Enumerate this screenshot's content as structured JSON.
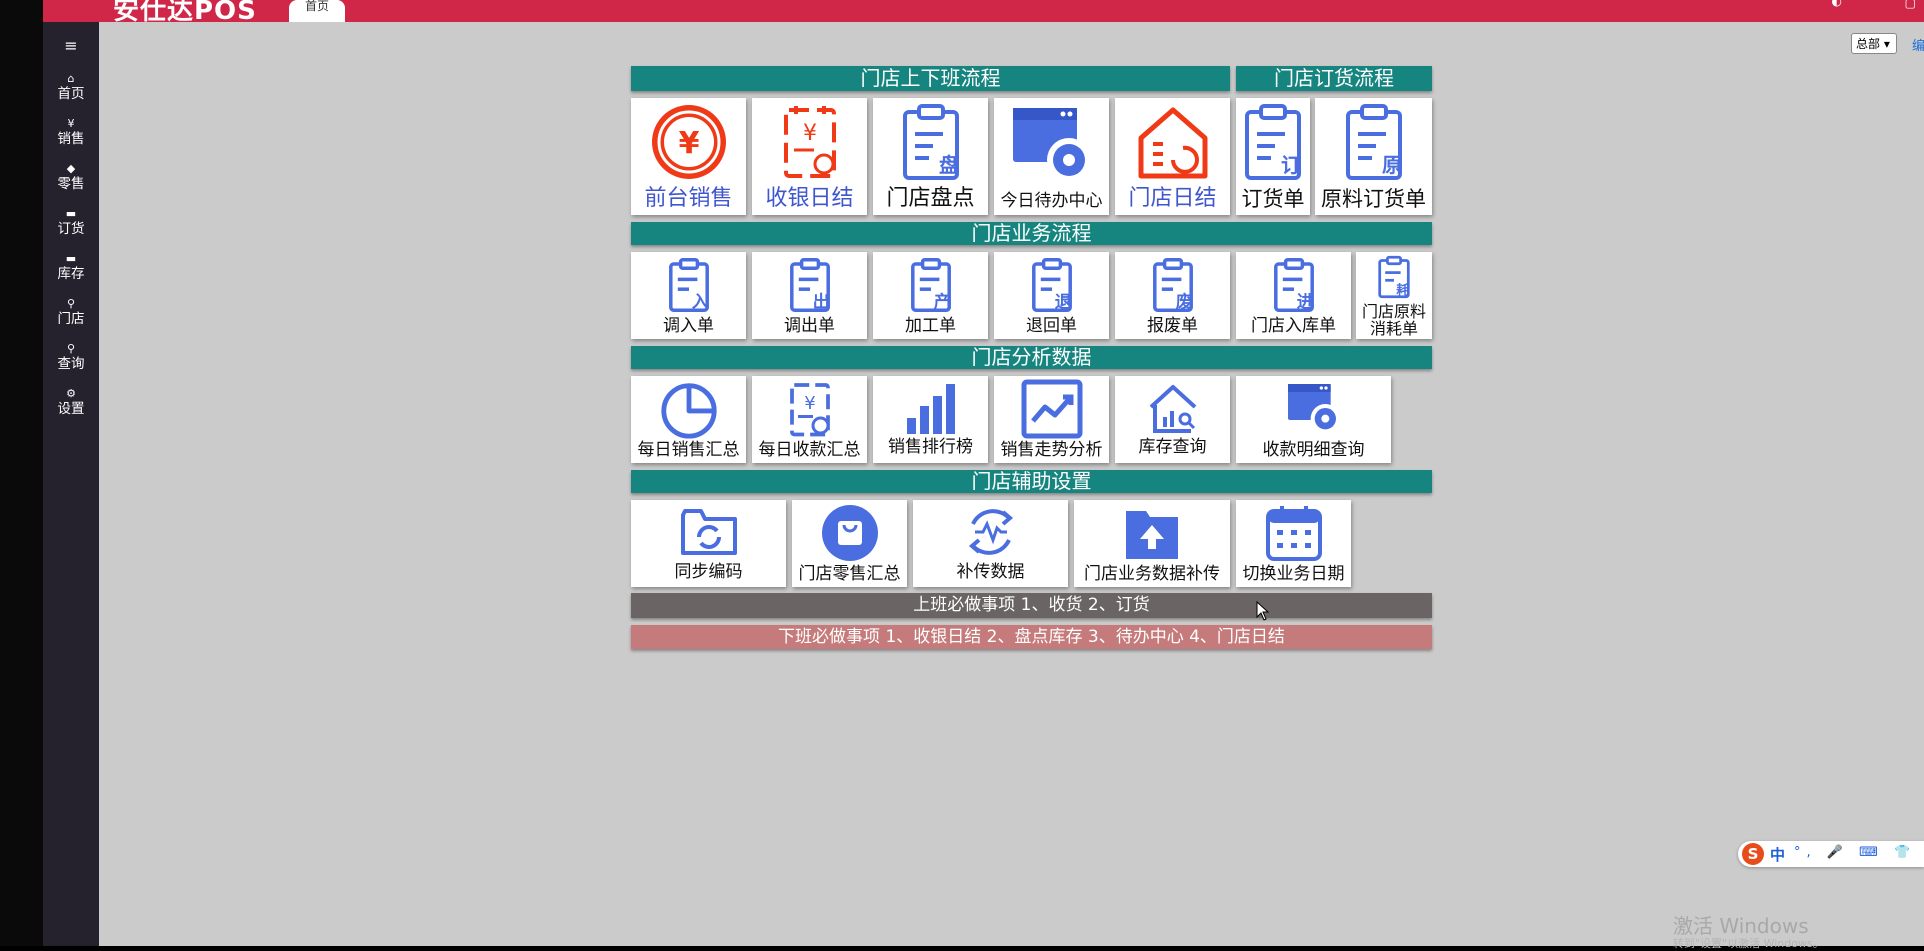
{
  "app": {
    "logo": "安仕达POS",
    "home_tab": "首页",
    "dept_select": "总部",
    "edit_link": "编"
  },
  "colors": {
    "topbar": "#d02648",
    "sidebar": "#25222e",
    "section": "#17857f",
    "blue_icon": "#4a6ee0",
    "red_icon": "#f03a17"
  },
  "sidebar": {
    "menu_icon": "hamburger-icon",
    "items": [
      {
        "label": "首页",
        "icon": "home-icon"
      },
      {
        "label": "销售",
        "icon": "yen-icon"
      },
      {
        "label": "零售",
        "icon": "tag-icon"
      },
      {
        "label": "订货",
        "icon": "box-icon"
      },
      {
        "label": "库存",
        "icon": "archive-icon"
      },
      {
        "label": "门店",
        "icon": "search-icon"
      },
      {
        "label": "查询",
        "icon": "search-icon"
      },
      {
        "label": "设置",
        "icon": "gear-icon"
      }
    ]
  },
  "sections": {
    "shift": "门店上下班流程",
    "order": "门店订货流程",
    "business": "门店业务流程",
    "analysis": "门店分析数据",
    "assist": "门店辅助设置"
  },
  "tiles": {
    "shift": [
      "前台销售",
      "收银日结",
      "门店盘点",
      "今日待办中心",
      "门店日结"
    ],
    "order": [
      "订货单",
      "原料订货单"
    ],
    "business": [
      "调入单",
      "调出单",
      "加工单",
      "退回单",
      "报废单",
      "门店入库单",
      "门店原料\n消耗单"
    ],
    "analysis": [
      "每日销售汇总",
      "每日收款汇总",
      "销售排行榜",
      "销售走势分析",
      "库存查询",
      "收款明细查询"
    ],
    "assist": [
      "同步编码",
      "门店零售汇总",
      "补传数据",
      "门店业务数据补传",
      "切换业务日期"
    ]
  },
  "badges": {
    "pan": "盘",
    "ding": "订",
    "yuan": "原",
    "ru": "入",
    "chu": "出",
    "chan": "产",
    "tui": "退",
    "fei": "废",
    "jin": "进",
    "hao": "耗"
  },
  "notes": {
    "onduty": "上班必做事项 1、收货 2、订货",
    "offduty": "下班必做事项 1、收银日结 2、盘点库存 3、待办中心 4、门店日结"
  },
  "ime": {
    "logo": "S",
    "mode": "中",
    "tools": "°, 🎤 ⌨ 👕 🎮 ⋮⋮"
  },
  "watermark": {
    "line1": "激活 Windows",
    "line2": "转到\"设置\"以激活 Windows。"
  }
}
